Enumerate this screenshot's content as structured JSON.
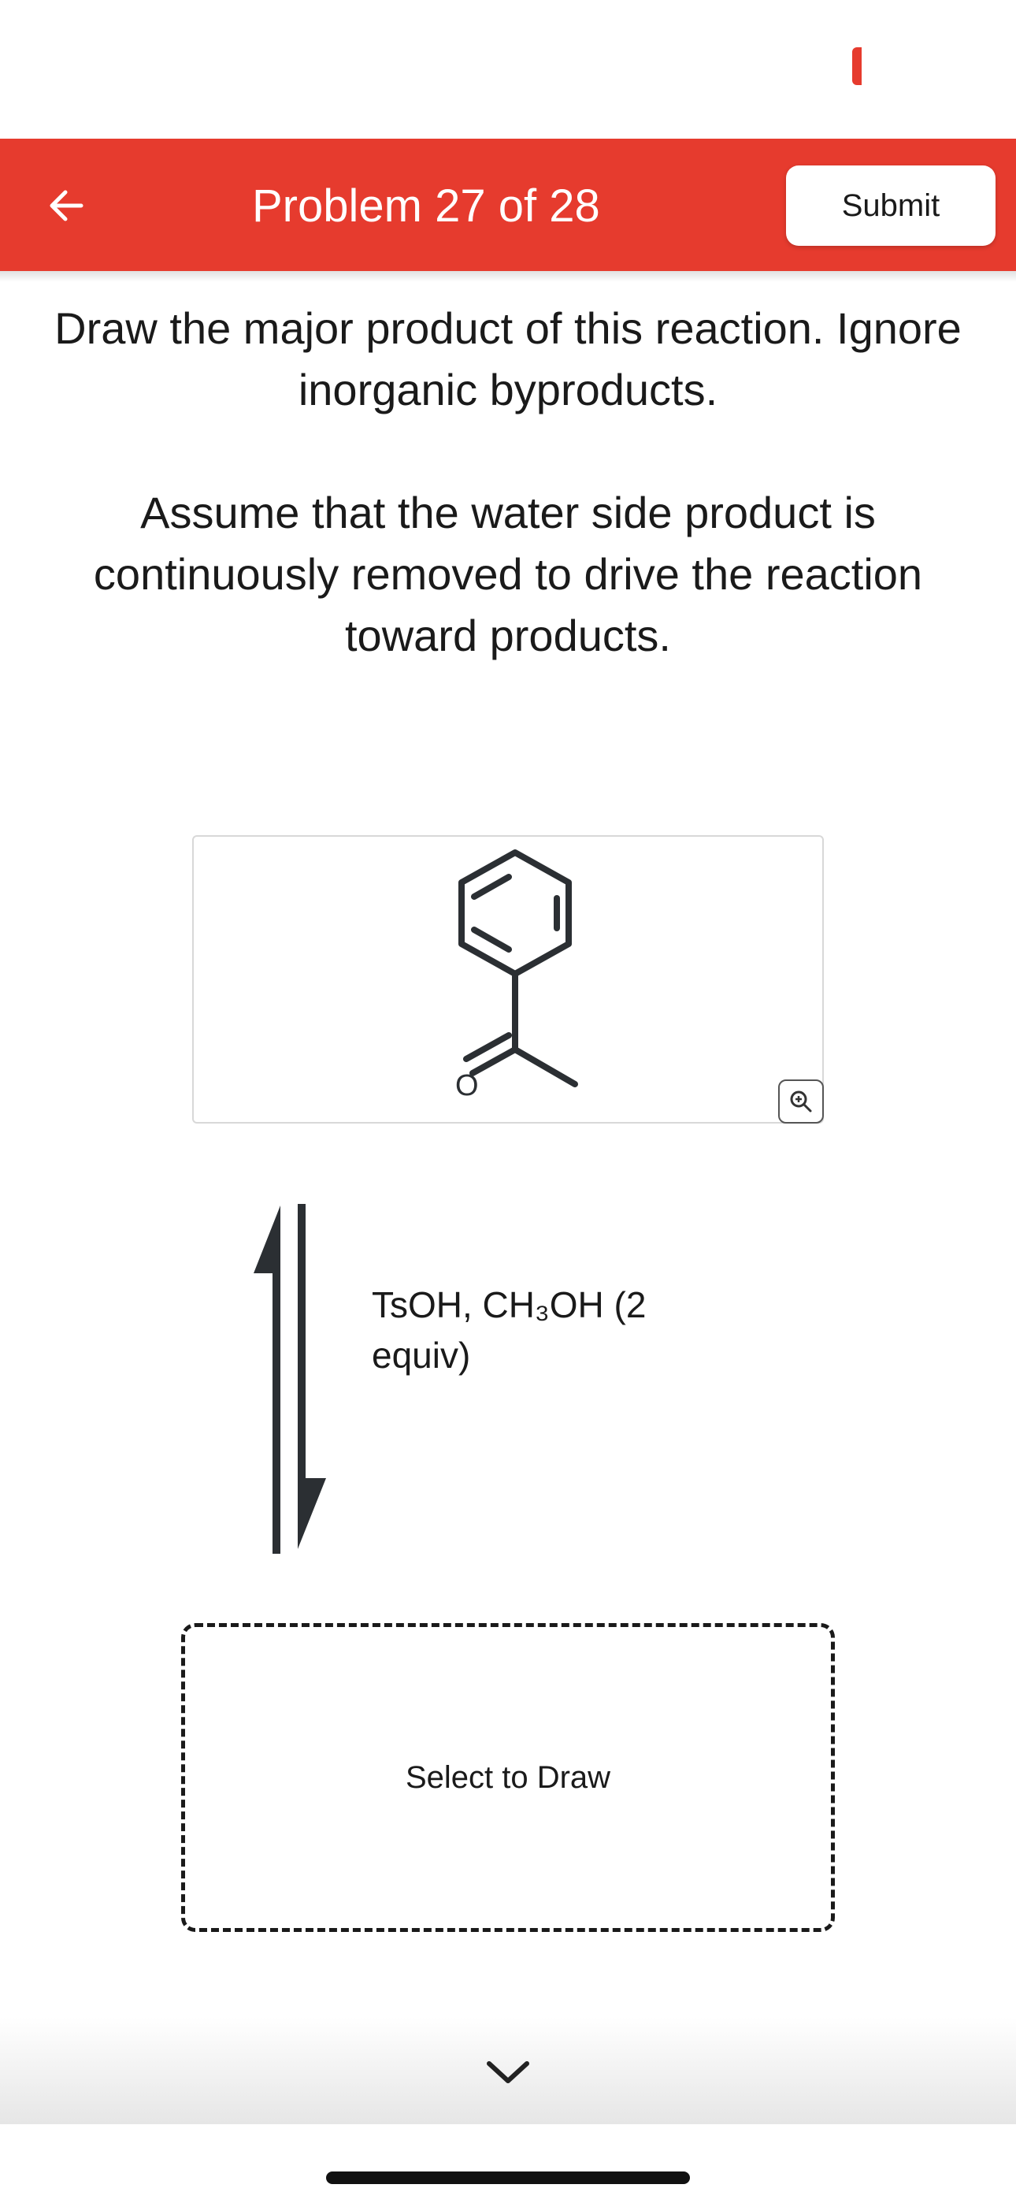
{
  "header": {
    "title": "Problem 27 of 28",
    "submit_label": "Submit",
    "accent_color": "#e63b2e"
  },
  "question": {
    "instruction": "Draw the major product of this reaction. Ignore inorganic byproducts.",
    "note": "Assume that the water side product is continuously removed to drive the reaction toward products."
  },
  "reactant": {
    "atom_label": "O",
    "zoom_icon": "zoom-in-icon"
  },
  "reaction": {
    "arrow_icon": "equilibrium-arrow-icon",
    "reagents": "TsOH, CH₃OH (2 equiv)"
  },
  "product": {
    "placeholder": "Select to Draw"
  },
  "footer": {
    "chevron_icon": "chevron-down-icon"
  }
}
